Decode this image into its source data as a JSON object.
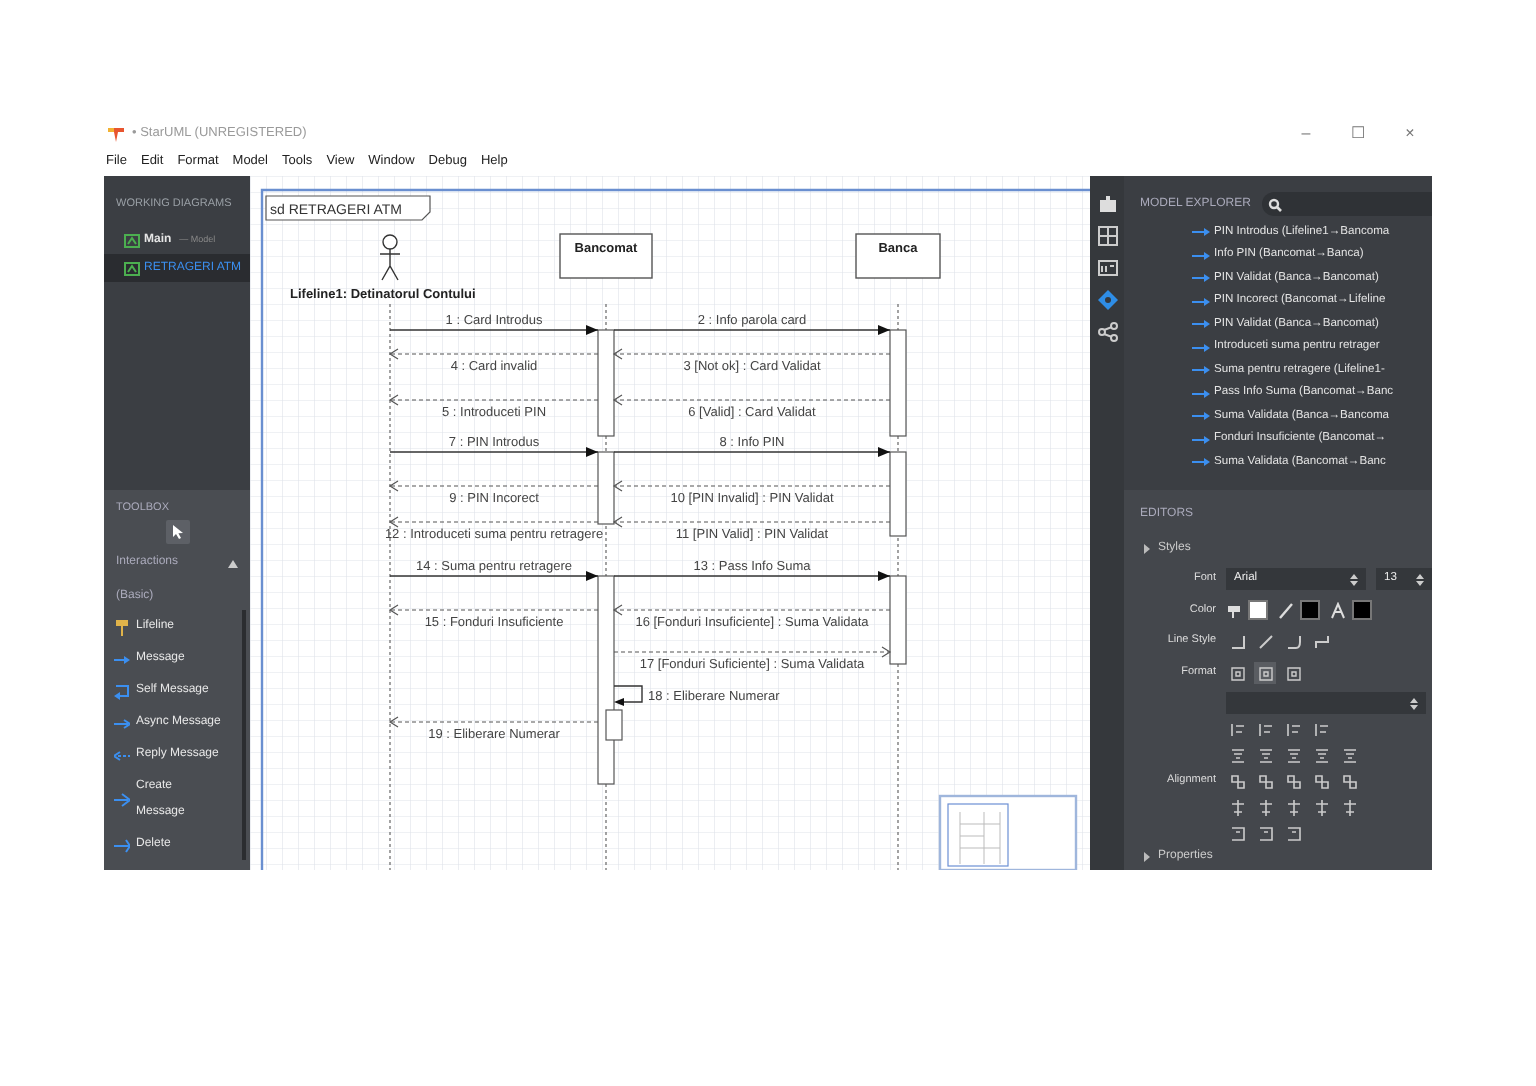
{
  "window": {
    "title": "• StarUML (UNREGISTERED)",
    "controls": [
      "–",
      "☐",
      "×"
    ]
  },
  "menu": [
    "File",
    "Edit",
    "Format",
    "Model",
    "Tools",
    "View",
    "Window",
    "Debug",
    "Help"
  ],
  "working_diagrams": {
    "title": "WORKING DIAGRAMS",
    "items": [
      {
        "name": "Main",
        "note": "— Model",
        "selected": false
      },
      {
        "name": "RETRAGERI ATM",
        "selected": true
      }
    ]
  },
  "toolbox": {
    "title": "TOOLBOX",
    "group": "Interactions",
    "subgroup": "(Basic)",
    "items": [
      {
        "kind": "lifeline",
        "label": "Lifeline"
      },
      {
        "kind": "message",
        "label": "Message"
      },
      {
        "kind": "self",
        "label": "Self Message"
      },
      {
        "kind": "async",
        "label": "Async Message"
      },
      {
        "kind": "reply",
        "label": "Reply Message"
      },
      {
        "kind": "create",
        "label": "Create Message"
      },
      {
        "kind": "delete",
        "label": "Delete"
      }
    ]
  },
  "diagram": {
    "frame_title": "sd RETRAGERI ATM",
    "lifelines": [
      {
        "kind": "actor",
        "name": "Lifeline1: Detinatorul Contului"
      },
      {
        "kind": "object",
        "name": "Bancomat"
      },
      {
        "kind": "object",
        "name": "Banca"
      }
    ],
    "rows": [
      [
        {
          "kind": "call",
          "right_lane": false,
          "leftward": false,
          "label": "1 : Card Introdus"
        },
        {
          "kind": "call",
          "right_lane": true,
          "leftward": false,
          "label": "2 : Info parola card"
        }
      ],
      [
        {
          "kind": "reply",
          "right_lane": false,
          "leftward": true,
          "label": "4 : Card invalid"
        },
        {
          "kind": "reply",
          "right_lane": true,
          "leftward": true,
          "label": "3 [Not ok] : Card Validat"
        }
      ],
      [
        {
          "kind": "reply",
          "right_lane": false,
          "leftward": true,
          "label": "5 : Introduceti PIN"
        },
        {
          "kind": "reply",
          "right_lane": true,
          "leftward": true,
          "label": "6 [Valid] : Card Validat"
        }
      ],
      [
        {
          "kind": "call",
          "right_lane": false,
          "leftward": false,
          "label": "7 : PIN Introdus"
        },
        {
          "kind": "call",
          "right_lane": true,
          "leftward": false,
          "label": "8 : Info PIN"
        }
      ],
      [
        {
          "kind": "reply",
          "right_lane": false,
          "leftward": true,
          "label": "9 : PIN Incorect"
        },
        {
          "kind": "reply",
          "right_lane": true,
          "leftward": true,
          "label": "10 [PIN Invalid] : PIN Validat"
        }
      ],
      [
        {
          "kind": "reply",
          "right_lane": false,
          "leftward": true,
          "label": "12 : Introduceti suma pentru retragere"
        },
        {
          "kind": "reply",
          "right_lane": true,
          "leftward": true,
          "label": "11 [PIN Valid] : PIN Validat"
        }
      ],
      [
        {
          "kind": "call",
          "right_lane": false,
          "leftward": false,
          "label": "14 : Suma pentru retragere"
        },
        {
          "kind": "call",
          "right_lane": true,
          "leftward": false,
          "label": "13 : Pass Info Suma"
        }
      ],
      [
        {
          "kind": "reply",
          "right_lane": false,
          "leftward": true,
          "label": "15 : Fonduri Insuficiente"
        },
        {
          "kind": "reply",
          "right_lane": true,
          "leftward": true,
          "label": "16 [Fonduri Insuficiente] : Suma Validata"
        }
      ],
      [
        {
          "kind": "reply",
          "right_lane": true,
          "leftward": false,
          "label": "17 [Fonduri Suficiente] : Suma Validata"
        }
      ],
      [
        {
          "kind": "self",
          "label": "18 : Eliberare Numerar"
        }
      ],
      [
        {
          "kind": "reply",
          "right_lane": false,
          "leftward": true,
          "label": "19 : Eliberare Numerar"
        }
      ]
    ]
  },
  "model_explorer": {
    "title": "MODEL EXPLORER",
    "items": [
      "PIN Introdus (Lifeline1→Bancoma",
      "Info PIN (Bancomat→Banca)",
      "PIN Validat (Banca→Bancomat)",
      "PIN Incorect (Bancomat→Lifeline",
      "PIN Validat (Banca→Bancomat)",
      "Introduceti suma pentru retrager",
      "Suma pentru retragere (Lifeline1-",
      "Pass Info Suma (Bancomat→Banc",
      "Suma Validata (Banca→Bancoma",
      "Fonduri Insuficiente (Bancomat→",
      "Suma Validata (Bancomat→Banc"
    ]
  },
  "editors": {
    "title": "EDITORS",
    "styles_title": "Styles",
    "font_label": "Font",
    "font": "Arial",
    "size": "13",
    "color_label": "Color",
    "swatches": [
      {
        "color": "#ffffff"
      },
      {
        "color": "#000000"
      },
      {
        "color": "#000000"
      }
    ],
    "line_style_label": "Line Style",
    "format_label": "Format",
    "alignment_label": "Alignment",
    "properties_title": "Properties"
  }
}
